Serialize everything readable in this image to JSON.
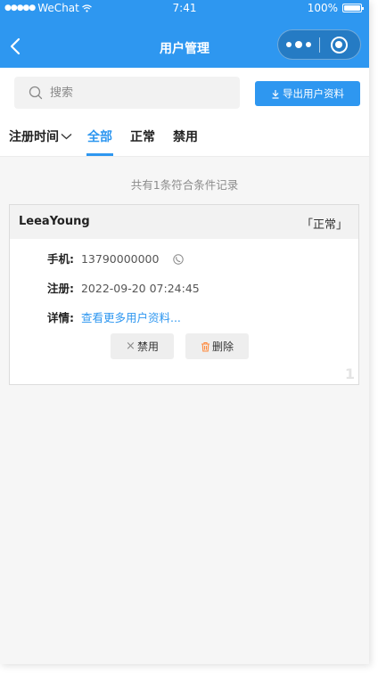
{
  "status_bar": {
    "signal": "●●●●●",
    "carrier": "WeChat",
    "time": "7:41",
    "battery": "100%"
  },
  "nav": {
    "title": "用户管理"
  },
  "search": {
    "placeholder": "搜索",
    "value": ""
  },
  "toolbar": {
    "export_label": "导出用户资料"
  },
  "tabs": {
    "sort_label": "注册时间",
    "items": [
      "全部",
      "正常",
      "禁用"
    ],
    "active": "全部"
  },
  "summary": "共有1条符合条件记录",
  "users": [
    {
      "name": "LeeaYoung",
      "status": "「正常」",
      "phone_label": "手机:",
      "phone": "13790000000",
      "register_label": "注册:",
      "register_time": "2022-09-20 07:24:45",
      "detail_label": "详情:",
      "detail_link": "查看更多用户资料...",
      "ban_label": "禁用",
      "delete_label": "删除",
      "index": "1"
    }
  ],
  "colors": {
    "primary": "#2e97f0",
    "background": "#f6f6f6",
    "delete_icon": "#ff8a3d"
  }
}
